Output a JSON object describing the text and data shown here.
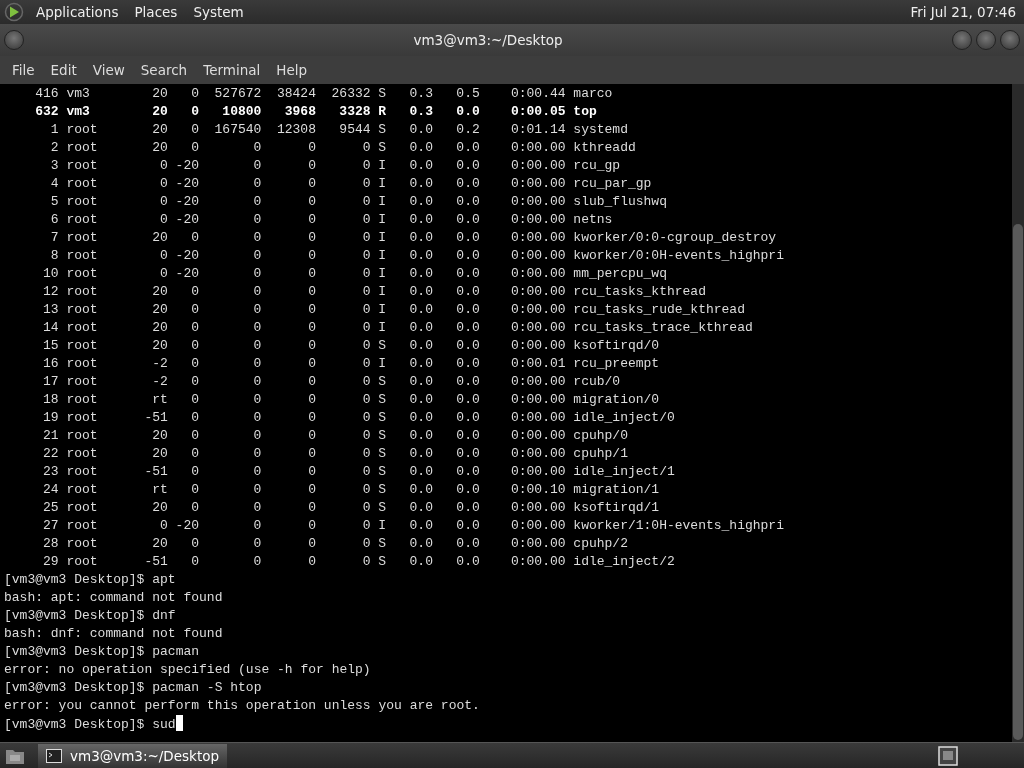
{
  "top_panel": {
    "menus": [
      "Applications",
      "Places",
      "System"
    ],
    "clock": "Fri Jul 21, 07:46"
  },
  "window": {
    "title": "vm3@vm3:~/Desktop",
    "menu": [
      "File",
      "Edit",
      "View",
      "Search",
      "Terminal",
      "Help"
    ]
  },
  "terminal": {
    "processes": [
      {
        "cells": [
          "416",
          "vm3",
          "20",
          "0",
          "527672",
          "38424",
          "26332",
          "S",
          "0.3",
          "0.5",
          "0:00.44",
          "marco"
        ],
        "bold": false
      },
      {
        "cells": [
          "632",
          "vm3",
          "20",
          "0",
          "10800",
          "3968",
          "3328",
          "R",
          "0.3",
          "0.0",
          "0:00.05",
          "top"
        ],
        "bold": true
      },
      {
        "cells": [
          "1",
          "root",
          "20",
          "0",
          "167540",
          "12308",
          "9544",
          "S",
          "0.0",
          "0.2",
          "0:01.14",
          "systemd"
        ],
        "bold": false
      },
      {
        "cells": [
          "2",
          "root",
          "20",
          "0",
          "0",
          "0",
          "0",
          "S",
          "0.0",
          "0.0",
          "0:00.00",
          "kthreadd"
        ],
        "bold": false
      },
      {
        "cells": [
          "3",
          "root",
          "0",
          "-20",
          "0",
          "0",
          "0",
          "I",
          "0.0",
          "0.0",
          "0:00.00",
          "rcu_gp"
        ],
        "bold": false
      },
      {
        "cells": [
          "4",
          "root",
          "0",
          "-20",
          "0",
          "0",
          "0",
          "I",
          "0.0",
          "0.0",
          "0:00.00",
          "rcu_par_gp"
        ],
        "bold": false
      },
      {
        "cells": [
          "5",
          "root",
          "0",
          "-20",
          "0",
          "0",
          "0",
          "I",
          "0.0",
          "0.0",
          "0:00.00",
          "slub_flushwq"
        ],
        "bold": false
      },
      {
        "cells": [
          "6",
          "root",
          "0",
          "-20",
          "0",
          "0",
          "0",
          "I",
          "0.0",
          "0.0",
          "0:00.00",
          "netns"
        ],
        "bold": false
      },
      {
        "cells": [
          "7",
          "root",
          "20",
          "0",
          "0",
          "0",
          "0",
          "I",
          "0.0",
          "0.0",
          "0:00.00",
          "kworker/0:0-cgroup_destroy"
        ],
        "bold": false
      },
      {
        "cells": [
          "8",
          "root",
          "0",
          "-20",
          "0",
          "0",
          "0",
          "I",
          "0.0",
          "0.0",
          "0:00.00",
          "kworker/0:0H-events_highpri"
        ],
        "bold": false
      },
      {
        "cells": [
          "10",
          "root",
          "0",
          "-20",
          "0",
          "0",
          "0",
          "I",
          "0.0",
          "0.0",
          "0:00.00",
          "mm_percpu_wq"
        ],
        "bold": false
      },
      {
        "cells": [
          "12",
          "root",
          "20",
          "0",
          "0",
          "0",
          "0",
          "I",
          "0.0",
          "0.0",
          "0:00.00",
          "rcu_tasks_kthread"
        ],
        "bold": false
      },
      {
        "cells": [
          "13",
          "root",
          "20",
          "0",
          "0",
          "0",
          "0",
          "I",
          "0.0",
          "0.0",
          "0:00.00",
          "rcu_tasks_rude_kthread"
        ],
        "bold": false
      },
      {
        "cells": [
          "14",
          "root",
          "20",
          "0",
          "0",
          "0",
          "0",
          "I",
          "0.0",
          "0.0",
          "0:00.00",
          "rcu_tasks_trace_kthread"
        ],
        "bold": false
      },
      {
        "cells": [
          "15",
          "root",
          "20",
          "0",
          "0",
          "0",
          "0",
          "S",
          "0.0",
          "0.0",
          "0:00.00",
          "ksoftirqd/0"
        ],
        "bold": false
      },
      {
        "cells": [
          "16",
          "root",
          "-2",
          "0",
          "0",
          "0",
          "0",
          "I",
          "0.0",
          "0.0",
          "0:00.01",
          "rcu_preempt"
        ],
        "bold": false
      },
      {
        "cells": [
          "17",
          "root",
          "-2",
          "0",
          "0",
          "0",
          "0",
          "S",
          "0.0",
          "0.0",
          "0:00.00",
          "rcub/0"
        ],
        "bold": false
      },
      {
        "cells": [
          "18",
          "root",
          "rt",
          "0",
          "0",
          "0",
          "0",
          "S",
          "0.0",
          "0.0",
          "0:00.00",
          "migration/0"
        ],
        "bold": false
      },
      {
        "cells": [
          "19",
          "root",
          "-51",
          "0",
          "0",
          "0",
          "0",
          "S",
          "0.0",
          "0.0",
          "0:00.00",
          "idle_inject/0"
        ],
        "bold": false
      },
      {
        "cells": [
          "21",
          "root",
          "20",
          "0",
          "0",
          "0",
          "0",
          "S",
          "0.0",
          "0.0",
          "0:00.00",
          "cpuhp/0"
        ],
        "bold": false
      },
      {
        "cells": [
          "22",
          "root",
          "20",
          "0",
          "0",
          "0",
          "0",
          "S",
          "0.0",
          "0.0",
          "0:00.00",
          "cpuhp/1"
        ],
        "bold": false
      },
      {
        "cells": [
          "23",
          "root",
          "-51",
          "0",
          "0",
          "0",
          "0",
          "S",
          "0.0",
          "0.0",
          "0:00.00",
          "idle_inject/1"
        ],
        "bold": false
      },
      {
        "cells": [
          "24",
          "root",
          "rt",
          "0",
          "0",
          "0",
          "0",
          "S",
          "0.0",
          "0.0",
          "0:00.10",
          "migration/1"
        ],
        "bold": false
      },
      {
        "cells": [
          "25",
          "root",
          "20",
          "0",
          "0",
          "0",
          "0",
          "S",
          "0.0",
          "0.0",
          "0:00.00",
          "ksoftirqd/1"
        ],
        "bold": false
      },
      {
        "cells": [
          "27",
          "root",
          "0",
          "-20",
          "0",
          "0",
          "0",
          "I",
          "0.0",
          "0.0",
          "0:00.00",
          "kworker/1:0H-events_highpri"
        ],
        "bold": false
      },
      {
        "cells": [
          "28",
          "root",
          "20",
          "0",
          "0",
          "0",
          "0",
          "S",
          "0.0",
          "0.0",
          "0:00.00",
          "cpuhp/2"
        ],
        "bold": false
      },
      {
        "cells": [
          "29",
          "root",
          "-51",
          "0",
          "0",
          "0",
          "0",
          "S",
          "0.0",
          "0.0",
          "0:00.00",
          "idle_inject/2"
        ],
        "bold": false
      }
    ],
    "lines": [
      "[vm3@vm3 Desktop]$ apt",
      "bash: apt: command not found",
      "[vm3@vm3 Desktop]$ dnf",
      "bash: dnf: command not found",
      "[vm3@vm3 Desktop]$ pacman",
      "error: no operation specified (use -h for help)",
      "[vm3@vm3 Desktop]$ pacman -S htop",
      "error: you cannot perform this operation unless you are root."
    ],
    "prompt": "[vm3@vm3 Desktop]$ sud"
  },
  "taskbar": {
    "tasks": [
      {
        "label": "vm3@vm3:~/Desktop",
        "selected": true
      }
    ]
  }
}
